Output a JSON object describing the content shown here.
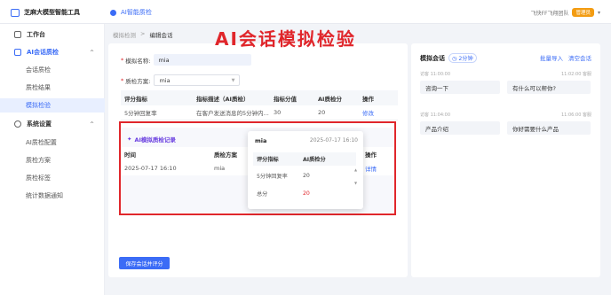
{
  "header": {
    "brand": "芝麻大模型智能工具",
    "nav_link": "AI智能质检",
    "user_text": "飞快FF飞翔团队",
    "user_badge": "管理员"
  },
  "sidebar": {
    "workbench": "工作台",
    "group1": {
      "label": "AI会话质检",
      "items": [
        "会话质检",
        "质检结果",
        "模拟检验"
      ]
    },
    "group2": {
      "label": "系统设置",
      "items": [
        "AI质检配置",
        "质检方案",
        "质检标签",
        "统计数据通知"
      ]
    }
  },
  "breadcrumb": {
    "parent": "模拟检测",
    "sep": ">",
    "current": "编辑会话"
  },
  "overlay_title": "AI会话模拟检验",
  "form": {
    "name_label": "模拟名称:",
    "name_value": "mia",
    "plan_label": "质检方案:",
    "plan_value": "mia"
  },
  "indicator_table": {
    "headers": [
      "评分指标",
      "指标描述（AI质检）",
      "指标分值",
      "AI质检分",
      "操作"
    ],
    "rows": [
      [
        "5分钟回复率",
        "在客户发送消息的5分钟内...",
        "30",
        "20",
        "修改"
      ]
    ]
  },
  "records": {
    "title": "AI模拟质检记录",
    "headers": [
      "时间",
      "质检方案",
      "操作"
    ],
    "rows": [
      [
        "2025-07-17 16:10",
        "mia",
        "详情"
      ]
    ]
  },
  "popup": {
    "name": "mia",
    "date": "2025-07-17 16:10",
    "headers": [
      "评分指标",
      "AI质检分"
    ],
    "rows": [
      [
        "5分钟回复率",
        "20"
      ]
    ],
    "total_label": "总分",
    "total_value": "20"
  },
  "save_button": "保存会话并评分",
  "chat": {
    "title": "模拟会话",
    "timer": "2分钟",
    "actions": [
      "批量导入",
      "清空会话"
    ],
    "messages": [
      {
        "side": "left",
        "meta": "访客   11:00:00",
        "text": "咨询一下"
      },
      {
        "side": "right",
        "meta": "11:02:00   客服",
        "text": "有什么可以帮你?"
      },
      {
        "side": "left",
        "meta": "访客   11:04:00",
        "text": "产品介绍"
      },
      {
        "side": "right",
        "meta": "11:06:00   客服",
        "text": "你好需要什么产品"
      }
    ]
  },
  "colors": {
    "accent": "#3b6cf6",
    "highlight": "#e0262b",
    "purple": "#6a3fe0"
  }
}
